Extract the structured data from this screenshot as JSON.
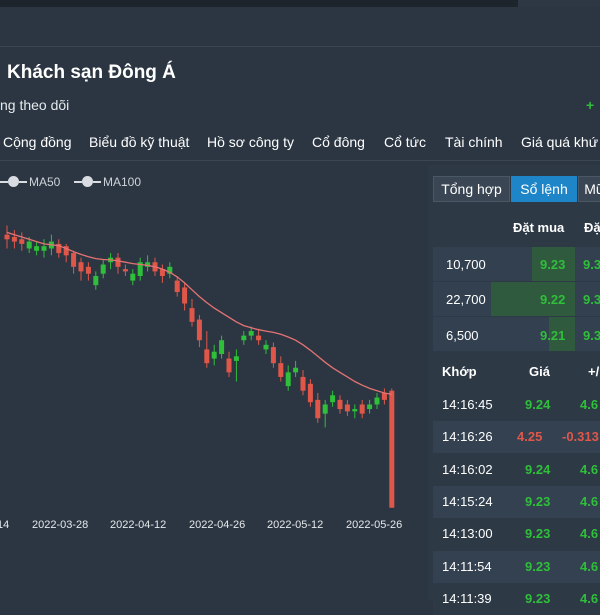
{
  "stock": {
    "title": "Khách sạn Đông Á",
    "follow_label": "ng theo dõi",
    "follow_change": "+"
  },
  "nav": [
    "Cộng đồng",
    "Biểu đồ kỹ thuật",
    "Hồ sơ công ty",
    "Cổ đông",
    "Cổ tức",
    "Tài chính",
    "Giá quá khứ"
  ],
  "legend": [
    "MA50",
    "MA100"
  ],
  "colors": {
    "up": "#2fbf3a",
    "down": "#e0574a",
    "accent": "#1e86c8",
    "ma": "#e57373"
  },
  "panel": {
    "tabs": [
      "Tổng hợp",
      "Sổ lệnh",
      "Mũ"
    ],
    "active_tab": "Sổ lệnh",
    "orderbook": {
      "headers": [
        "Đặt mua",
        "Đặ"
      ],
      "rows": [
        {
          "volume": "10,700",
          "bid": "9.23",
          "ask": "9.3"
        },
        {
          "volume": "22,700",
          "bid": "9.22",
          "ask": "9.3"
        },
        {
          "volume": "6,500",
          "bid": "9.21",
          "ask": "9.3"
        }
      ]
    },
    "trades": {
      "headers": [
        "Khớp",
        "Giá",
        "+/"
      ],
      "rows": [
        {
          "time": "14:16:45",
          "price": "9.24",
          "change": "4.6",
          "dir": "up"
        },
        {
          "time": "14:16:26",
          "price": "4.25",
          "change": "-0.313",
          "dir": "down"
        },
        {
          "time": "14:16:02",
          "price": "9.24",
          "change": "4.6",
          "dir": "up"
        },
        {
          "time": "14:15:24",
          "price": "9.23",
          "change": "4.6",
          "dir": "up"
        },
        {
          "time": "14:13:00",
          "price": "9.23",
          "change": "4.6",
          "dir": "up"
        },
        {
          "time": "14:11:54",
          "price": "9.23",
          "change": "4.6",
          "dir": "up"
        },
        {
          "time": "14:11:39",
          "price": "9.23",
          "change": "4.6",
          "dir": "up"
        }
      ]
    }
  },
  "chart_data": {
    "type": "candlestick",
    "x_tick_labels": [
      "14",
      "2022-03-28",
      "2022-04-12",
      "2022-04-26",
      "2022-05-12",
      "2022-05-26"
    ],
    "legend": [
      "MA50",
      "MA100"
    ],
    "price_range": [
      4.2,
      11.0
    ],
    "candles": [
      {
        "o": 10.2,
        "c": 10.1,
        "h": 10.4,
        "l": 9.9
      },
      {
        "o": 10.15,
        "c": 10.05,
        "h": 10.3,
        "l": 9.9
      },
      {
        "o": 10.1,
        "c": 10.0,
        "h": 10.25,
        "l": 9.85
      },
      {
        "o": 9.9,
        "c": 10.05,
        "h": 10.15,
        "l": 9.8
      },
      {
        "o": 9.85,
        "c": 9.95,
        "h": 10.05,
        "l": 9.75
      },
      {
        "o": 9.85,
        "c": 9.95,
        "h": 10.1,
        "l": 9.7
      },
      {
        "o": 9.9,
        "c": 10.05,
        "h": 10.2,
        "l": 9.75
      },
      {
        "o": 10.0,
        "c": 9.8,
        "h": 10.1,
        "l": 9.7
      },
      {
        "o": 9.95,
        "c": 9.75,
        "h": 10.0,
        "l": 9.6
      },
      {
        "o": 9.8,
        "c": 9.5,
        "h": 9.85,
        "l": 9.35
      },
      {
        "o": 9.6,
        "c": 9.4,
        "h": 9.7,
        "l": 9.2
      },
      {
        "o": 9.5,
        "c": 9.35,
        "h": 9.6,
        "l": 9.2
      },
      {
        "o": 9.1,
        "c": 9.3,
        "h": 9.4,
        "l": 9.0
      },
      {
        "o": 9.35,
        "c": 9.55,
        "h": 9.65,
        "l": 9.25
      },
      {
        "o": 9.6,
        "c": 9.7,
        "h": 9.8,
        "l": 9.45
      },
      {
        "o": 9.7,
        "c": 9.5,
        "h": 9.8,
        "l": 9.35
      },
      {
        "o": 9.45,
        "c": 9.4,
        "h": 9.55,
        "l": 9.3
      },
      {
        "o": 9.2,
        "c": 9.35,
        "h": 9.45,
        "l": 9.1
      },
      {
        "o": 9.3,
        "c": 9.6,
        "h": 9.7,
        "l": 9.2
      },
      {
        "o": 9.5,
        "c": 9.6,
        "h": 9.75,
        "l": 9.4
      },
      {
        "o": 9.6,
        "c": 9.4,
        "h": 9.7,
        "l": 9.3
      },
      {
        "o": 9.45,
        "c": 9.3,
        "h": 9.55,
        "l": 9.15
      },
      {
        "o": 9.35,
        "c": 9.5,
        "h": 9.6,
        "l": 9.25
      },
      {
        "o": 9.2,
        "c": 8.95,
        "h": 9.3,
        "l": 8.85
      },
      {
        "o": 9.05,
        "c": 8.7,
        "h": 9.15,
        "l": 8.55
      },
      {
        "o": 8.6,
        "c": 8.3,
        "h": 8.8,
        "l": 8.2
      },
      {
        "o": 8.35,
        "c": 7.9,
        "h": 8.45,
        "l": 7.75
      },
      {
        "o": 7.7,
        "c": 7.4,
        "h": 8.1,
        "l": 7.3
      },
      {
        "o": 7.5,
        "c": 7.65,
        "h": 7.8,
        "l": 7.35
      },
      {
        "o": 7.6,
        "c": 7.9,
        "h": 8.0,
        "l": 7.5
      },
      {
        "o": 7.5,
        "c": 7.2,
        "h": 7.65,
        "l": 7.1
      },
      {
        "o": 7.45,
        "c": 7.55,
        "h": 7.7,
        "l": 7.0
      },
      {
        "o": 7.9,
        "c": 8.0,
        "h": 8.1,
        "l": 7.8
      },
      {
        "o": 8.0,
        "c": 8.1,
        "h": 8.2,
        "l": 7.9
      },
      {
        "o": 8.0,
        "c": 7.9,
        "h": 8.15,
        "l": 7.8
      },
      {
        "o": 7.7,
        "c": 7.8,
        "h": 7.9,
        "l": 7.6
      },
      {
        "o": 7.75,
        "c": 7.4,
        "h": 7.85,
        "l": 7.3
      },
      {
        "o": 7.4,
        "c": 7.1,
        "h": 7.55,
        "l": 7.0
      },
      {
        "o": 6.9,
        "c": 7.2,
        "h": 7.35,
        "l": 6.8
      },
      {
        "o": 7.2,
        "c": 7.3,
        "h": 7.45,
        "l": 7.1
      },
      {
        "o": 7.1,
        "c": 6.8,
        "h": 7.25,
        "l": 6.7
      },
      {
        "o": 6.95,
        "c": 6.55,
        "h": 7.05,
        "l": 6.45
      },
      {
        "o": 6.6,
        "c": 6.2,
        "h": 6.75,
        "l": 6.1
      },
      {
        "o": 6.3,
        "c": 6.5,
        "h": 6.6,
        "l": 6.0
      },
      {
        "o": 6.55,
        "c": 6.7,
        "h": 6.8,
        "l": 6.45
      },
      {
        "o": 6.6,
        "c": 6.4,
        "h": 6.7,
        "l": 6.3
      },
      {
        "o": 6.5,
        "c": 6.35,
        "h": 6.6,
        "l": 6.25
      },
      {
        "o": 6.35,
        "c": 6.4,
        "h": 6.5,
        "l": 6.2
      },
      {
        "o": 6.5,
        "c": 6.3,
        "h": 6.6,
        "l": 6.2
      },
      {
        "o": 6.4,
        "c": 6.5,
        "h": 6.6,
        "l": 6.3
      },
      {
        "o": 6.5,
        "c": 6.65,
        "h": 6.75,
        "l": 6.4
      },
      {
        "o": 6.75,
        "c": 6.6,
        "h": 6.85,
        "l": 6.5
      },
      {
        "o": 6.8,
        "c": 4.25,
        "h": 6.85,
        "l": 4.25
      }
    ],
    "ma": [
      10.25,
      10.2,
      10.15,
      10.1,
      10.05,
      10.0,
      9.98,
      9.96,
      9.9,
      9.83,
      9.77,
      9.72,
      9.68,
      9.66,
      9.65,
      9.63,
      9.6,
      9.57,
      9.55,
      9.53,
      9.5,
      9.45,
      9.38,
      9.28,
      9.15,
      9.0,
      8.85,
      8.72,
      8.6,
      8.5,
      8.4,
      8.3,
      8.22,
      8.17,
      8.13,
      8.1,
      8.07,
      8.03,
      7.97,
      7.9,
      7.8,
      7.68,
      7.55,
      7.42,
      7.3,
      7.2,
      7.1,
      7.0,
      6.92,
      6.85,
      6.8,
      6.75,
      6.72
    ]
  }
}
